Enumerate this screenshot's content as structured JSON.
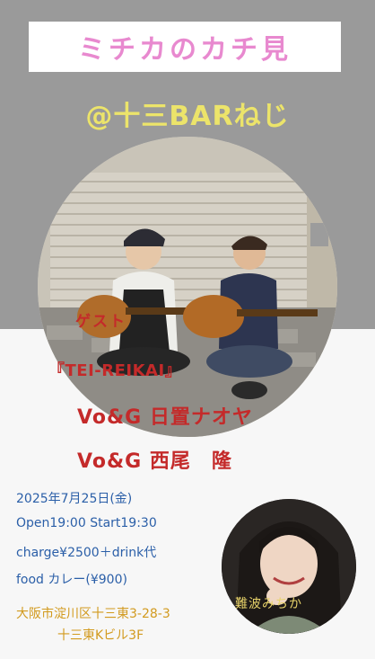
{
  "flyer": {
    "title": "ミチカのカチ見",
    "venue": "@十三BARねじ",
    "guest_label": "ゲスト",
    "guest_name": "『TEI-REIKAI』",
    "members": [
      "Vo&G 日置ナオヤ",
      "Vo&G 西尾　隆"
    ],
    "date": "2025年7月25日(金)",
    "times": "Open19:00  Start19:30",
    "charge": "charge¥2500＋drink代",
    "food": "food カレー(¥900)",
    "address_line1": "大阪市淀川区十三東3-28-3",
    "address_line2": "十三東Kビル3F",
    "profile_name": "難波みちか"
  },
  "colors": {
    "title_pink": "#e889cf",
    "venue_yellow": "#ece46a",
    "guest_red": "#c42a2a",
    "info_blue": "#2b5fa8",
    "address_gold": "#d29a1e",
    "gray_band": "#9a9a9a"
  }
}
